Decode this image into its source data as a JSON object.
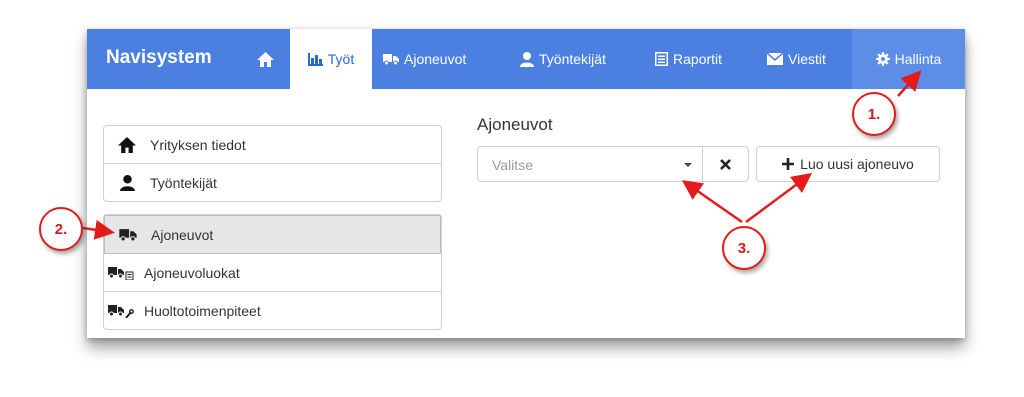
{
  "navbar": {
    "brand": "Navisystem",
    "items": [
      {
        "label": "",
        "icon": "home-icon"
      },
      {
        "label": "Työt",
        "icon": "chart-icon",
        "active": true
      },
      {
        "label": "Ajoneuvot",
        "icon": "truck-icon"
      },
      {
        "label": "Työntekijät",
        "icon": "user-icon"
      },
      {
        "label": "Raportit",
        "icon": "list-icon"
      },
      {
        "label": "Viestit",
        "icon": "envelope-icon"
      },
      {
        "label": "Hallinta",
        "icon": "gear-icon"
      }
    ]
  },
  "sidebar": {
    "group1": [
      {
        "label": "Yrityksen tiedot",
        "icon": "home-icon"
      },
      {
        "label": "Työntekijät",
        "icon": "user-icon"
      }
    ],
    "group2": [
      {
        "label": "Ajoneuvot",
        "icon": "truck-icon",
        "active": true
      },
      {
        "label": "Ajoneuvoluokat",
        "icon": "truck-list-icon"
      },
      {
        "label": "Huoltotoimenpiteet",
        "icon": "truck-wrench-icon"
      }
    ]
  },
  "main": {
    "heading": "Ajoneuvot",
    "select_placeholder": "Valitse",
    "create_button": "Luo uusi ajoneuvo"
  },
  "annotations": {
    "step1": "1.",
    "step2": "2.",
    "step3": "3.",
    "color": "#e41b1b"
  },
  "colors": {
    "navbar": "#4b80e0",
    "active_tab_text": "#2a6ad0"
  }
}
